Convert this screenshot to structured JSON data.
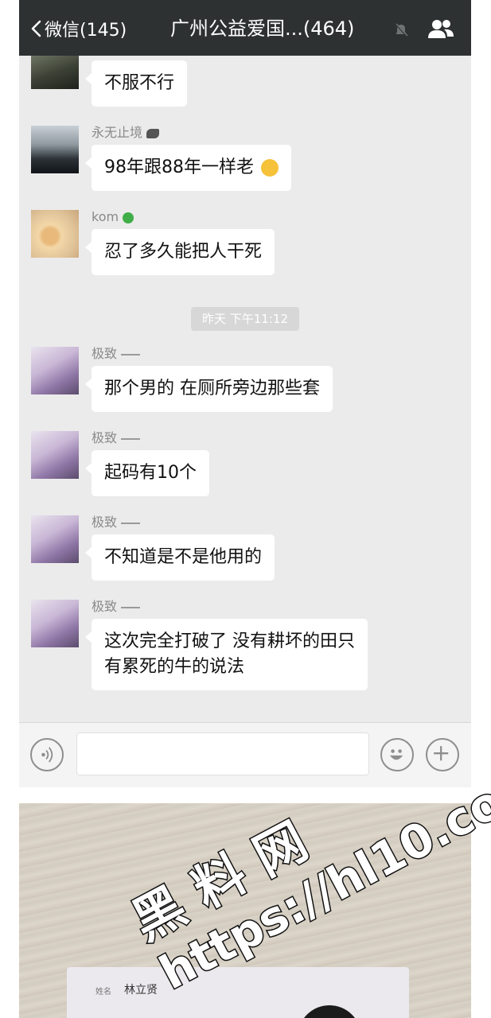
{
  "header": {
    "back_label": "微信(145)",
    "title": "广州公益爱国...(464)"
  },
  "messages": [
    {
      "sender": "",
      "text": "不服不行"
    },
    {
      "sender": "永无止境",
      "text": "98年跟88年一样老"
    },
    {
      "sender": "kom",
      "text": "忍了多久能把人干死"
    },
    {
      "sender": "极致",
      "text": "那个男的 在厕所旁边那些套"
    },
    {
      "sender": "极致",
      "text": "起码有10个"
    },
    {
      "sender": "极致",
      "text": "不知道是不是他用的"
    },
    {
      "sender": "极致",
      "text_line1": "这次完全打破了 没有耕坏的田只",
      "text_line2": "有累死的牛的说法"
    }
  ],
  "timestamp": "昨天 下午11:12",
  "photo": {
    "card_label": "姓名",
    "card_name": "林立贤"
  },
  "watermark": {
    "line1": "黑 料 网",
    "line2": "https://hl10.co"
  },
  "colors": {
    "topbar": "#2e3132",
    "chat_background": "#ebebeb",
    "bubble": "#ffffff",
    "sender_name": "#8a8a8a"
  }
}
